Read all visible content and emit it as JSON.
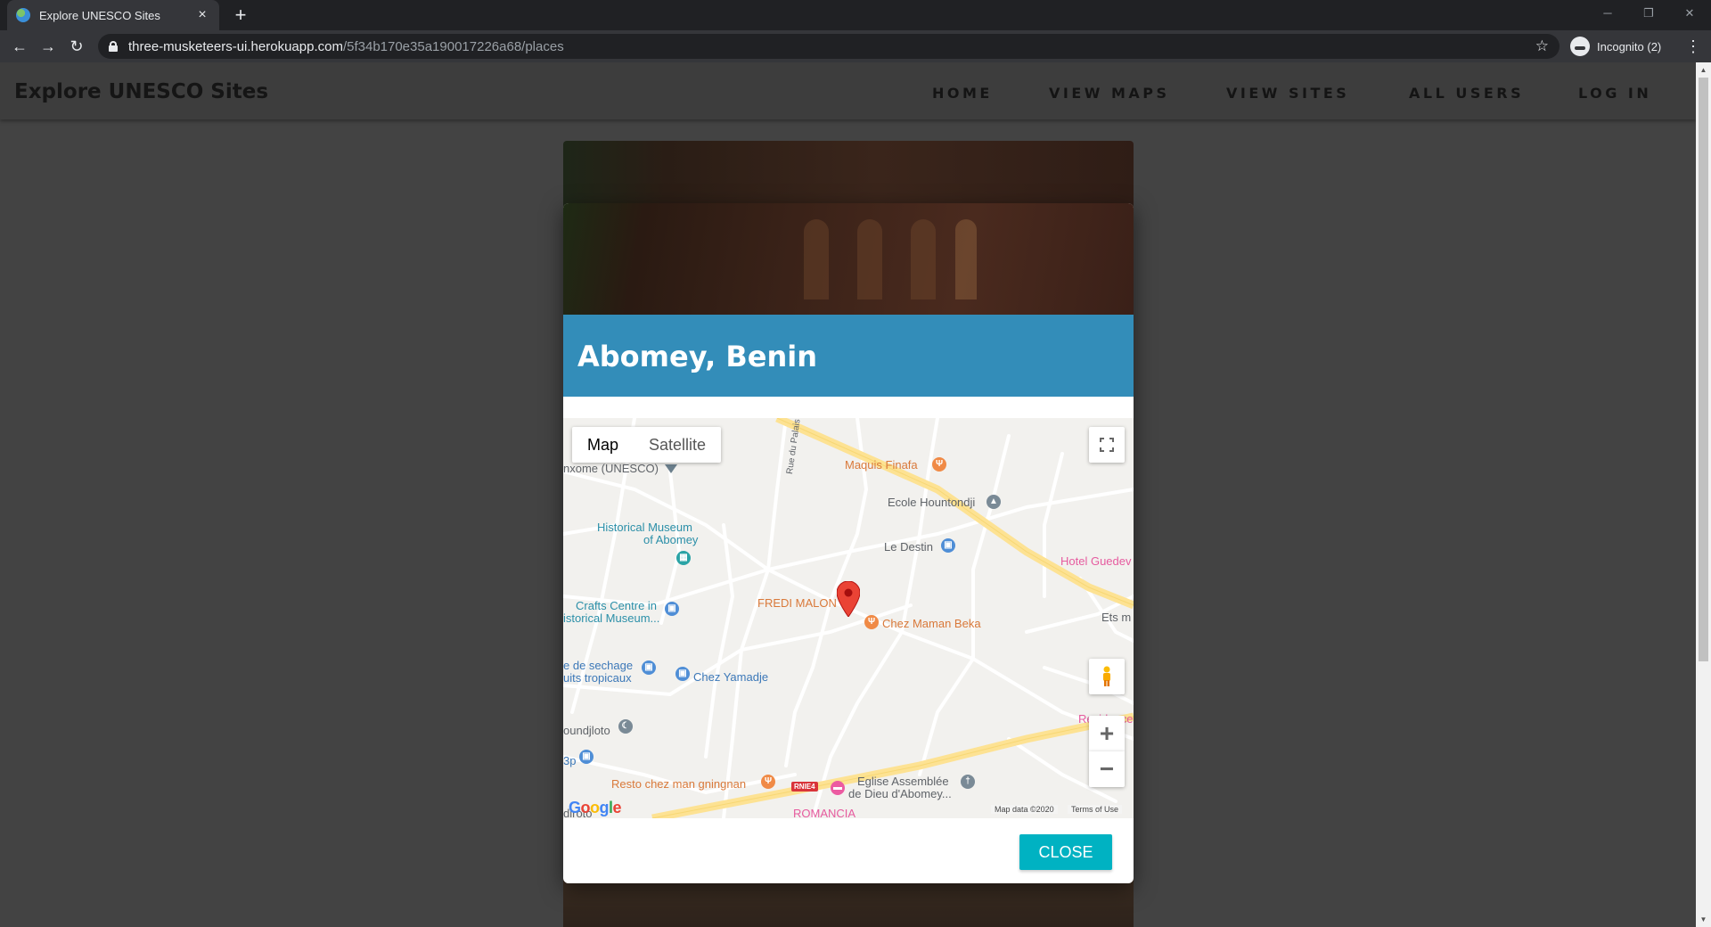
{
  "browser": {
    "tab_title": "Explore UNESCO Sites",
    "url_host": "three-musketeers-ui.herokuapp.com",
    "url_path": "/5f34b170e35a190017226a68/places",
    "incognito_label": "Incognito (2)"
  },
  "site": {
    "brand": "Explore UNESCO Sites",
    "nav": [
      "HOME",
      "VIEW MAPS",
      "VIEW SITES",
      "ALL USERS",
      "LOG IN"
    ]
  },
  "modal": {
    "title": "Abomey, Benin",
    "close_label": "CLOSE"
  },
  "map": {
    "type_buttons": [
      "Map",
      "Satellite"
    ],
    "active_type": "Map",
    "labels": {
      "unesco": "nxome (UNESCO)",
      "rue": "Rue du Palais Royal",
      "maquis": "Maquis Finafa",
      "ecole": "Ecole Hountondji",
      "museum_1": "Historical Museum",
      "museum_2": "of Abomey",
      "le_destin": "Le Destin",
      "hotel": "Hotel Guedev",
      "crafts_1": "Crafts Centre in",
      "crafts_2": "istorical Museum...",
      "fredi": "FREDI MALON",
      "maman": "Chez Maman Beka",
      "ets": "Ets m",
      "sechage_1": "e de sechage",
      "sechage_2": "uits tropicaux",
      "yamadje": "Chez Yamadje",
      "residence": "Residence",
      "houndjloto": "oundjloto",
      "bp": "3p",
      "resto": "Resto chez man gningnan",
      "eglise_1": "Eglise Assemblée",
      "eglise_2": "de Dieu d'Abomey...",
      "romancia": "ROMANCIA",
      "diroto": "diroto",
      "road_badge": "RNIE4"
    },
    "attribution": "Map data ©2020",
    "terms": "Terms of Use",
    "logo": "Google"
  },
  "colors": {
    "title_bar": "#338db9",
    "close_button": "#00b2c2",
    "overlay": "#434343"
  }
}
